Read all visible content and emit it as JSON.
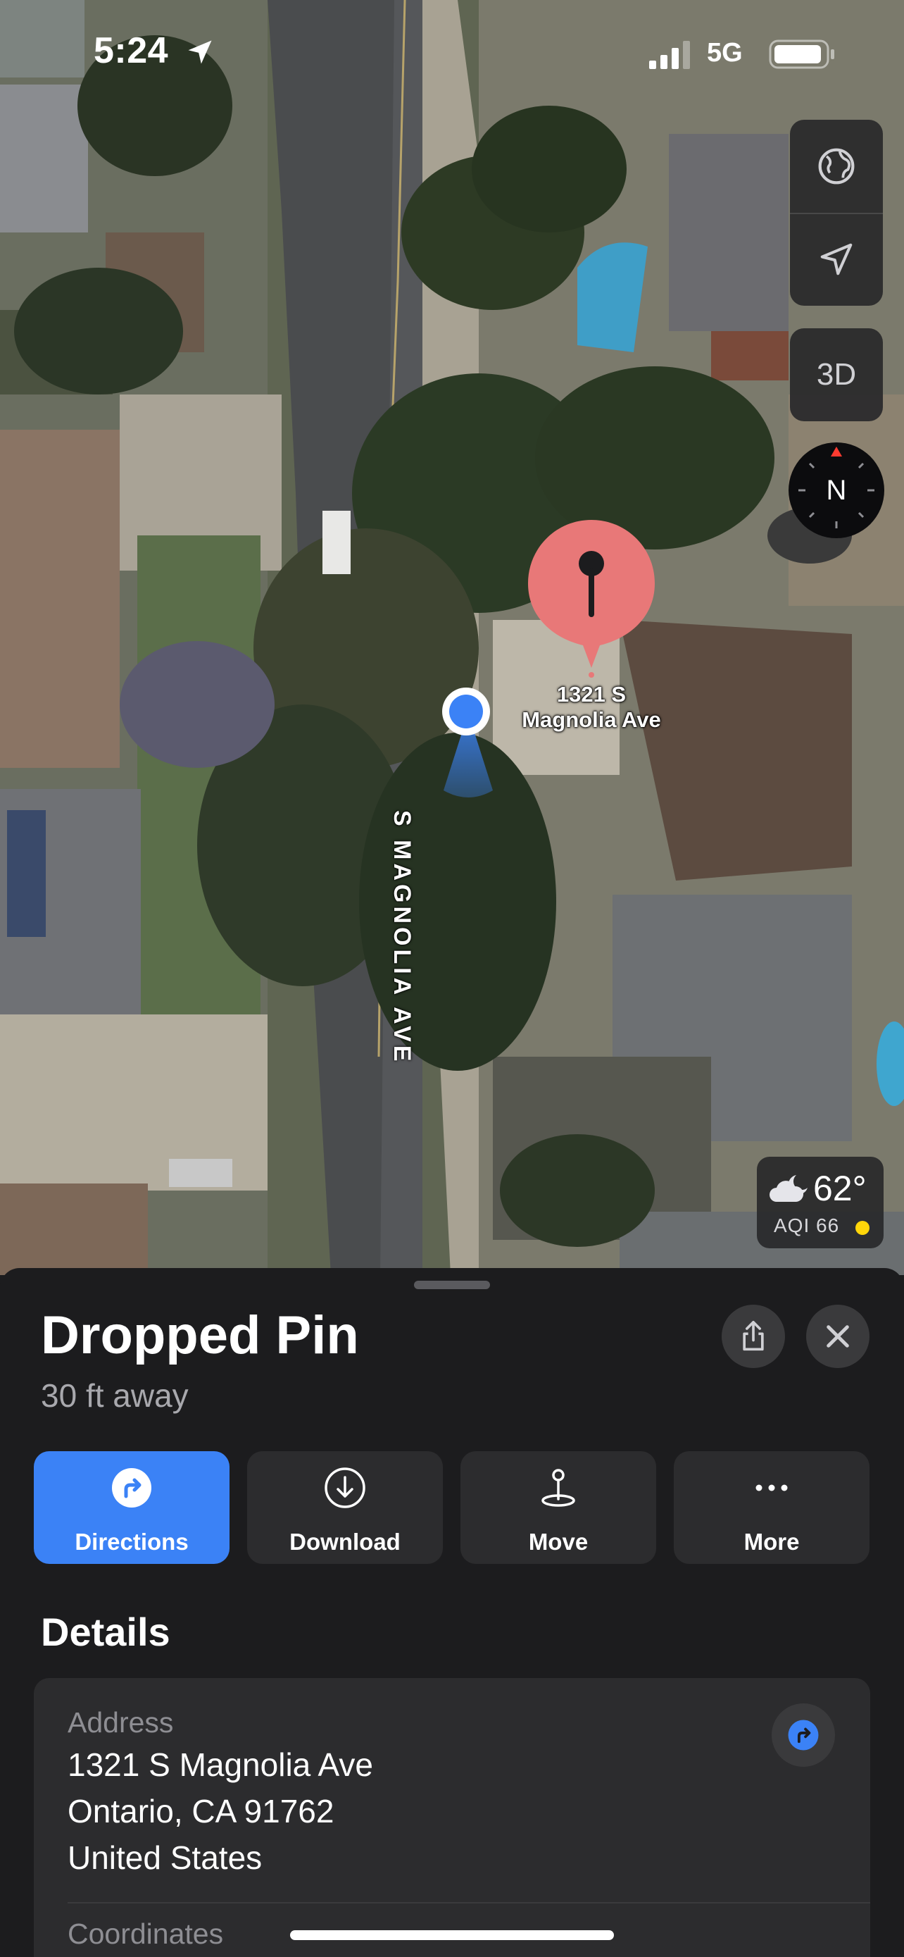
{
  "status_bar": {
    "time": "5:24",
    "network": "5G",
    "location_icon": "location-arrow-icon",
    "signal_icon": "signal-bars-icon",
    "battery_icon": "battery-icon"
  },
  "map": {
    "controls": {
      "globe_icon": "globe-icon",
      "tracking_icon": "location-arrow-icon",
      "three_d_label": "3D",
      "compass_label": "N"
    },
    "pin": {
      "label_line1": "1321 S",
      "label_line2": "Magnolia Ave",
      "color": "#e87878"
    },
    "street_label": "S MAGNOLIA AVE",
    "weather": {
      "temperature": "62°",
      "aqi": "AQI 66",
      "icon": "cloud-moon-icon"
    }
  },
  "sheet": {
    "title": "Dropped Pin",
    "subtitle": "30 ft away",
    "actions": [
      {
        "label": "Directions",
        "icon": "directions-icon"
      },
      {
        "label": "Download",
        "icon": "download-icon"
      },
      {
        "label": "Move",
        "icon": "move-pin-icon"
      },
      {
        "label": "More",
        "icon": "ellipsis-icon"
      }
    ],
    "details_heading": "Details",
    "address": {
      "label": "Address",
      "line1": "1321 S Magnolia Ave",
      "line2": "Ontario, CA  91762",
      "line3": "United States"
    },
    "coordinates_label": "Coordinates"
  },
  "colors": {
    "accent": "#3b82f6",
    "sheet_bg": "#1c1c1e",
    "card_bg": "#2c2c2e"
  }
}
